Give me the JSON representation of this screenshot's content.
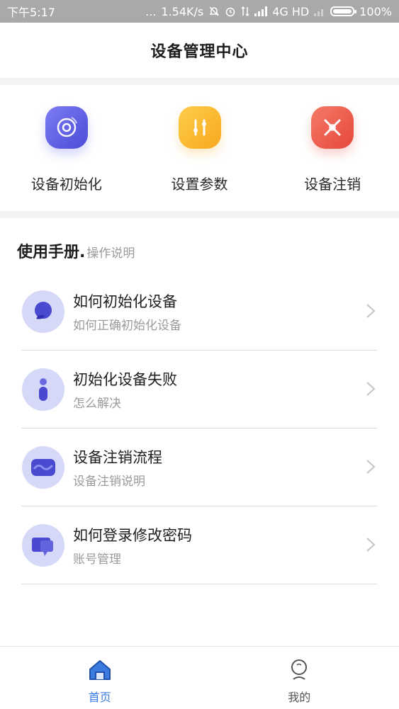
{
  "status_bar": {
    "time": "下午5:17",
    "dots": "...",
    "speed": "1.54K/s",
    "network": "4G HD",
    "battery": "100%"
  },
  "header": {
    "title": "设备管理中心"
  },
  "actions": [
    {
      "label": "设备初始化",
      "icon": "disc-icon",
      "color": "#5f5fe6"
    },
    {
      "label": "设置参数",
      "icon": "sliders-icon",
      "color": "#f7b52a"
    },
    {
      "label": "设备注销",
      "icon": "cancel-icon",
      "color": "#ee5f50"
    }
  ],
  "manual": {
    "title": "使用手册.",
    "subtitle": "操作说明",
    "items": [
      {
        "title": "如何初始化设备",
        "subtitle": "如何正确初始化设备",
        "icon": "bubble-icon"
      },
      {
        "title": "初始化设备失败",
        "subtitle": "怎么解决",
        "icon": "info-icon"
      },
      {
        "title": "设备注销流程",
        "subtitle": "设备注销说明",
        "icon": "wave-icon"
      },
      {
        "title": "如何登录修改密码",
        "subtitle": "账号管理",
        "icon": "message-icon"
      }
    ]
  },
  "tabbar": {
    "tabs": [
      {
        "label": "首页",
        "icon": "home-icon",
        "active": true
      },
      {
        "label": "我的",
        "icon": "profile-icon",
        "active": false
      }
    ],
    "active_color": "#3a7be0"
  }
}
